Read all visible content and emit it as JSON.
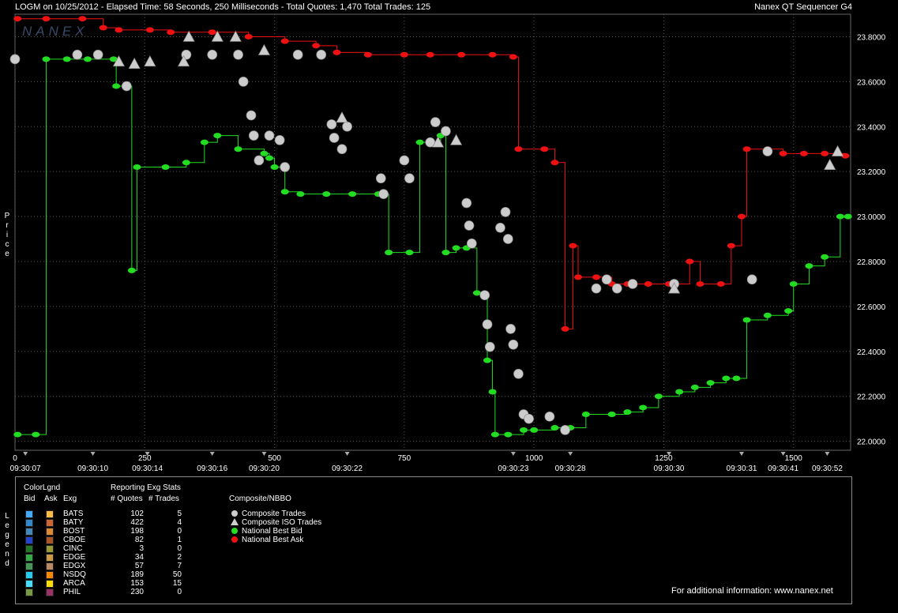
{
  "header": {
    "left": "LOGM on 10/25/2012  -  Elapsed Time: 58 Seconds, 250 Milliseconds  -  Total Quotes: 1,470  Total Trades: 125",
    "right": "Nanex QT Sequencer G4",
    "watermark": "NANEX"
  },
  "chart_data": {
    "type": "scatter",
    "ylabel": "Price",
    "y_ticks": [
      "23.8000",
      "23.6000",
      "23.4000",
      "23.2000",
      "23.0000",
      "22.8000",
      "22.6000",
      "22.4000",
      "22.2000",
      "22.0000"
    ],
    "ylim": [
      21.96,
      23.9
    ],
    "xlim": [
      0,
      1610
    ],
    "x_ticks": [
      0,
      250,
      500,
      750,
      1000,
      1250,
      1500
    ],
    "time_labels": [
      {
        "seq": 20,
        "label": "09:30:07"
      },
      {
        "seq": 150,
        "label": "09:30:10"
      },
      {
        "seq": 255,
        "label": "09:30:14"
      },
      {
        "seq": 380,
        "label": "09:30:16"
      },
      {
        "seq": 480,
        "label": "09:30:20"
      },
      {
        "seq": 640,
        "label": "09:30:22"
      },
      {
        "seq": 960,
        "label": "09:30:23"
      },
      {
        "seq": 1070,
        "label": "09:30:28"
      },
      {
        "seq": 1260,
        "label": "09:30:30"
      },
      {
        "seq": 1400,
        "label": "09:30:31"
      },
      {
        "seq": 1480,
        "label": "09:30:41"
      },
      {
        "seq": 1565,
        "label": "09:30:52"
      }
    ],
    "series": [
      {
        "name": "National Best Bid",
        "color": "#22dd22",
        "points": [
          [
            5,
            22.03
          ],
          [
            40,
            22.03
          ],
          [
            60,
            23.7
          ],
          [
            100,
            23.7
          ],
          [
            140,
            23.7
          ],
          [
            190,
            23.7
          ],
          [
            195,
            23.58
          ],
          [
            225,
            22.76
          ],
          [
            235,
            23.22
          ],
          [
            290,
            23.22
          ],
          [
            330,
            23.24
          ],
          [
            365,
            23.33
          ],
          [
            390,
            23.36
          ],
          [
            430,
            23.3
          ],
          [
            480,
            23.28
          ],
          [
            490,
            23.26
          ],
          [
            500,
            23.22
          ],
          [
            520,
            23.11
          ],
          [
            550,
            23.1
          ],
          [
            600,
            23.1
          ],
          [
            650,
            23.1
          ],
          [
            700,
            23.1
          ],
          [
            720,
            22.84
          ],
          [
            760,
            22.84
          ],
          [
            780,
            23.33
          ],
          [
            820,
            23.36
          ],
          [
            830,
            22.84
          ],
          [
            850,
            22.86
          ],
          [
            870,
            22.86
          ],
          [
            890,
            22.66
          ],
          [
            910,
            22.36
          ],
          [
            920,
            22.22
          ],
          [
            925,
            22.03
          ],
          [
            950,
            22.03
          ],
          [
            980,
            22.05
          ],
          [
            1000,
            22.05
          ],
          [
            1040,
            22.06
          ],
          [
            1070,
            22.06
          ],
          [
            1100,
            22.12
          ],
          [
            1150,
            22.12
          ],
          [
            1180,
            22.13
          ],
          [
            1210,
            22.15
          ],
          [
            1240,
            22.2
          ],
          [
            1280,
            22.22
          ],
          [
            1310,
            22.24
          ],
          [
            1340,
            22.26
          ],
          [
            1370,
            22.28
          ],
          [
            1390,
            22.28
          ],
          [
            1410,
            22.54
          ],
          [
            1450,
            22.56
          ],
          [
            1490,
            22.58
          ],
          [
            1500,
            22.7
          ],
          [
            1530,
            22.78
          ],
          [
            1560,
            22.82
          ],
          [
            1590,
            23.0
          ],
          [
            1605,
            23.0
          ]
        ]
      },
      {
        "name": "National Best Ask",
        "color": "#ee1111",
        "points": [
          [
            5,
            23.88
          ],
          [
            60,
            23.88
          ],
          [
            130,
            23.88
          ],
          [
            170,
            23.84
          ],
          [
            200,
            23.83
          ],
          [
            260,
            23.83
          ],
          [
            300,
            23.82
          ],
          [
            380,
            23.82
          ],
          [
            450,
            23.8
          ],
          [
            520,
            23.78
          ],
          [
            580,
            23.76
          ],
          [
            620,
            23.73
          ],
          [
            680,
            23.72
          ],
          [
            750,
            23.72
          ],
          [
            800,
            23.72
          ],
          [
            860,
            23.72
          ],
          [
            920,
            23.72
          ],
          [
            960,
            23.71
          ],
          [
            970,
            23.3
          ],
          [
            1020,
            23.3
          ],
          [
            1040,
            23.24
          ],
          [
            1060,
            22.5
          ],
          [
            1075,
            22.87
          ],
          [
            1085,
            22.73
          ],
          [
            1120,
            22.73
          ],
          [
            1150,
            22.7
          ],
          [
            1180,
            22.7
          ],
          [
            1220,
            22.7
          ],
          [
            1260,
            22.7
          ],
          [
            1300,
            22.8
          ],
          [
            1320,
            22.7
          ],
          [
            1360,
            22.7
          ],
          [
            1380,
            22.87
          ],
          [
            1400,
            23.0
          ],
          [
            1410,
            23.3
          ],
          [
            1450,
            23.3
          ],
          [
            1480,
            23.28
          ],
          [
            1520,
            23.28
          ],
          [
            1560,
            23.28
          ],
          [
            1600,
            23.27
          ]
        ]
      }
    ],
    "trades": {
      "composite": [
        [
          0,
          23.7
        ],
        [
          120,
          23.72
        ],
        [
          160,
          23.72
        ],
        [
          215,
          23.58
        ],
        [
          330,
          23.72
        ],
        [
          380,
          23.72
        ],
        [
          430,
          23.72
        ],
        [
          440,
          23.6
        ],
        [
          455,
          23.45
        ],
        [
          460,
          23.36
        ],
        [
          470,
          23.25
        ],
        [
          490,
          23.36
        ],
        [
          510,
          23.34
        ],
        [
          520,
          23.22
        ],
        [
          545,
          23.72
        ],
        [
          590,
          23.72
        ],
        [
          610,
          23.41
        ],
        [
          615,
          23.35
        ],
        [
          630,
          23.3
        ],
        [
          640,
          23.4
        ],
        [
          705,
          23.17
        ],
        [
          710,
          23.1
        ],
        [
          750,
          23.25
        ],
        [
          760,
          23.17
        ],
        [
          800,
          23.33
        ],
        [
          810,
          23.42
        ],
        [
          830,
          23.38
        ],
        [
          870,
          23.06
        ],
        [
          875,
          22.96
        ],
        [
          880,
          22.88
        ],
        [
          905,
          22.65
        ],
        [
          910,
          22.52
        ],
        [
          915,
          22.42
        ],
        [
          935,
          22.95
        ],
        [
          945,
          23.02
        ],
        [
          950,
          22.9
        ],
        [
          955,
          22.5
        ],
        [
          960,
          22.43
        ],
        [
          970,
          22.3
        ],
        [
          980,
          22.12
        ],
        [
          990,
          22.1
        ],
        [
          1030,
          22.11
        ],
        [
          1060,
          22.05
        ],
        [
          1120,
          22.68
        ],
        [
          1140,
          22.72
        ],
        [
          1160,
          22.68
        ],
        [
          1190,
          22.7
        ],
        [
          1270,
          22.7
        ],
        [
          1450,
          23.29
        ],
        [
          1420,
          22.72
        ]
      ],
      "iso": [
        [
          200,
          23.69
        ],
        [
          230,
          23.68
        ],
        [
          260,
          23.69
        ],
        [
          325,
          23.69
        ],
        [
          335,
          23.8
        ],
        [
          390,
          23.8
        ],
        [
          425,
          23.8
        ],
        [
          480,
          23.74
        ],
        [
          630,
          23.44
        ],
        [
          815,
          23.33
        ],
        [
          850,
          23.34
        ],
        [
          1270,
          22.68
        ],
        [
          1570,
          23.23
        ],
        [
          1585,
          23.29
        ]
      ]
    }
  },
  "legend": {
    "color_title": "ColorLgnd",
    "stats_title": "Reporting Exg Stats",
    "col_bid": "Bid",
    "col_ask": "Ask",
    "col_exg": "Exg",
    "col_quotes": "# Quotes",
    "col_trades": "# Trades",
    "rows": [
      {
        "exg": "BATS",
        "quotes": "102",
        "trades": "5",
        "bid": "#44aaff",
        "ask": "#ffbb44"
      },
      {
        "exg": "BATY",
        "quotes": "422",
        "trades": "4",
        "bid": "#3388cc",
        "ask": "#cc6633"
      },
      {
        "exg": "BOST",
        "quotes": "198",
        "trades": "0",
        "bid": "#4488bb",
        "ask": "#dd8833"
      },
      {
        "exg": "CBOE",
        "quotes": "82",
        "trades": "1",
        "bid": "#2244cc",
        "ask": "#aa5522"
      },
      {
        "exg": "CINC",
        "quotes": "3",
        "trades": "0",
        "bid": "#227722",
        "ask": "#999933"
      },
      {
        "exg": "EDGE",
        "quotes": "34",
        "trades": "2",
        "bid": "#33aa44",
        "ask": "#cc9944"
      },
      {
        "exg": "EDGX",
        "quotes": "57",
        "trades": "7",
        "bid": "#449955",
        "ask": "#bb8866"
      },
      {
        "exg": "NSDQ",
        "quotes": "189",
        "trades": "50",
        "bid": "#22ccee",
        "ask": "#ff8800"
      },
      {
        "exg": "ARCA",
        "quotes": "153",
        "trades": "15",
        "bid": "#44ddff",
        "ask": "#ffdd00"
      },
      {
        "exg": "PHIL",
        "quotes": "230",
        "trades": "0",
        "bid": "#779944",
        "ask": "#993366"
      }
    ],
    "nbbo_title": "Composite/NBBO",
    "nbbo_items": [
      {
        "label": "Composite Trades",
        "shape": "circle",
        "color": "#cccccc"
      },
      {
        "label": "Composite ISO Trades",
        "shape": "triangle",
        "color": "#cccccc"
      },
      {
        "label": "National Best Bid",
        "shape": "circle",
        "color": "#22dd22"
      },
      {
        "label": "National Best Ask",
        "shape": "circle",
        "color": "#ee1111"
      }
    ],
    "footer": "For additional information: www.nanex.net"
  },
  "side_labels": {
    "price": "Price",
    "legend": "Legend"
  }
}
